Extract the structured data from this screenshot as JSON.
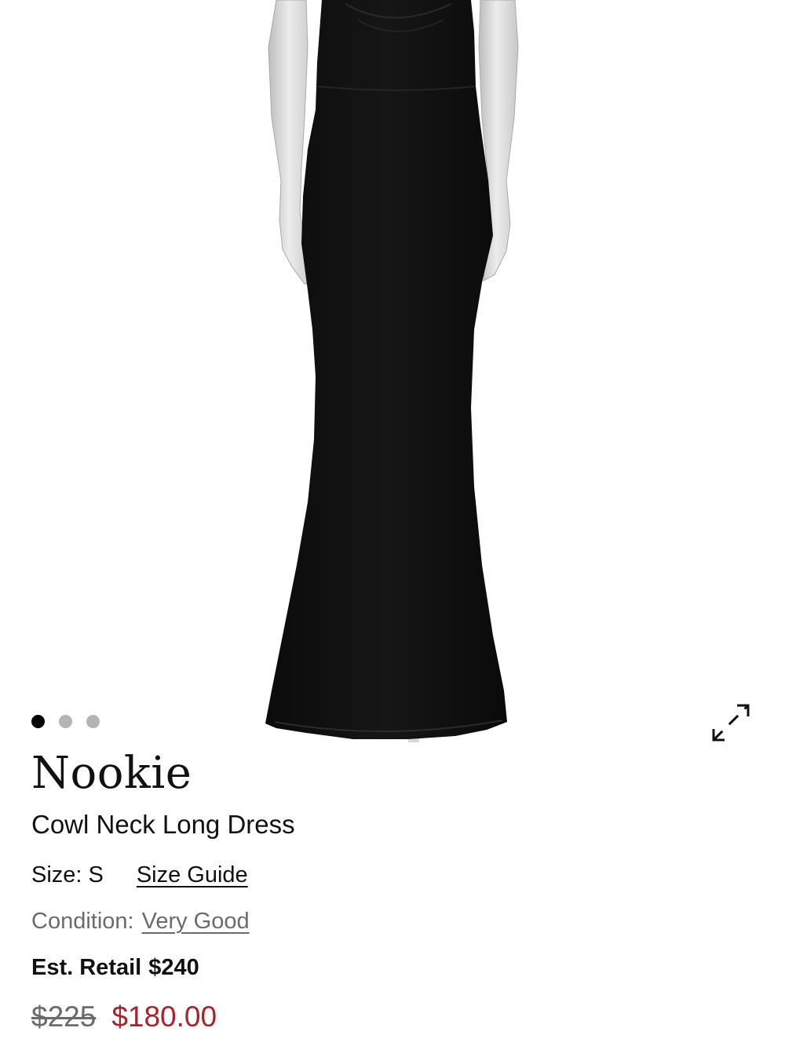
{
  "gallery": {
    "image_count": 3,
    "active_index": 0,
    "colors": {
      "active_dot": "#000000",
      "inactive_dot": "#b4b4b4"
    },
    "expand_icon": "expand-diagonal-arrows-icon"
  },
  "product": {
    "brand": "Nookie",
    "name": "Cowl Neck Long Dress",
    "size_label": "Size:",
    "size_value": "S",
    "size_guide_label": "Size Guide",
    "condition_label": "Condition:",
    "condition_value": "Very Good",
    "retail_label": "Est. Retail",
    "retail_value": "$240",
    "original_price": "$225",
    "sale_price": "$180.00",
    "colors": {
      "sale_price": "#a8232a",
      "muted_text": "#6b6b6b"
    }
  }
}
